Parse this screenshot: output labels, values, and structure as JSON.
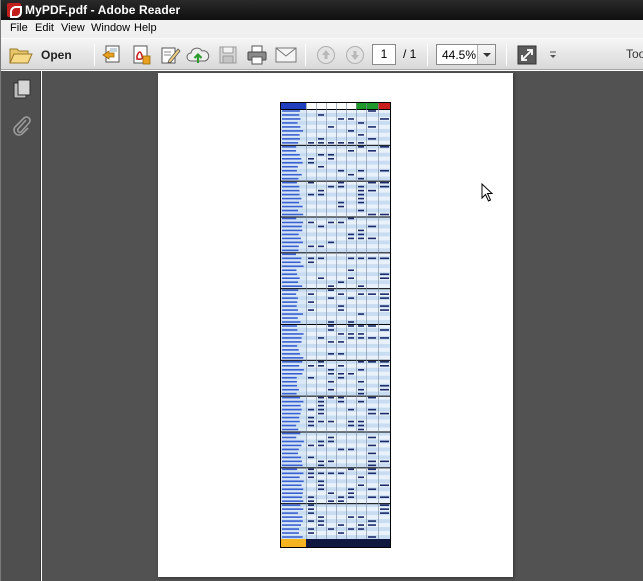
{
  "window": {
    "title": "MyPDF.pdf - Adobe Reader"
  },
  "menu": {
    "file": "File",
    "edit": "Edit",
    "view": "View",
    "window": "Window",
    "help": "Help"
  },
  "toolbar": {
    "open_label": "Open",
    "page_current": "1",
    "page_total": "/ 1",
    "zoom": "44.5%",
    "tools_label": "Too"
  },
  "colors": {
    "title_bar": "#1a1a1a",
    "sidebar": "#4f4f4f",
    "doc_background": "#525252",
    "sheet_header_blue": "#1f3fbf",
    "sheet_cell_light": "#c9ddf2",
    "sheet_cell_white": "#e9f1fa",
    "sheet_total_orange": "#f5b520",
    "sheet_header_green": "#1f9a2a",
    "sheet_header_red": "#c81e1e"
  }
}
